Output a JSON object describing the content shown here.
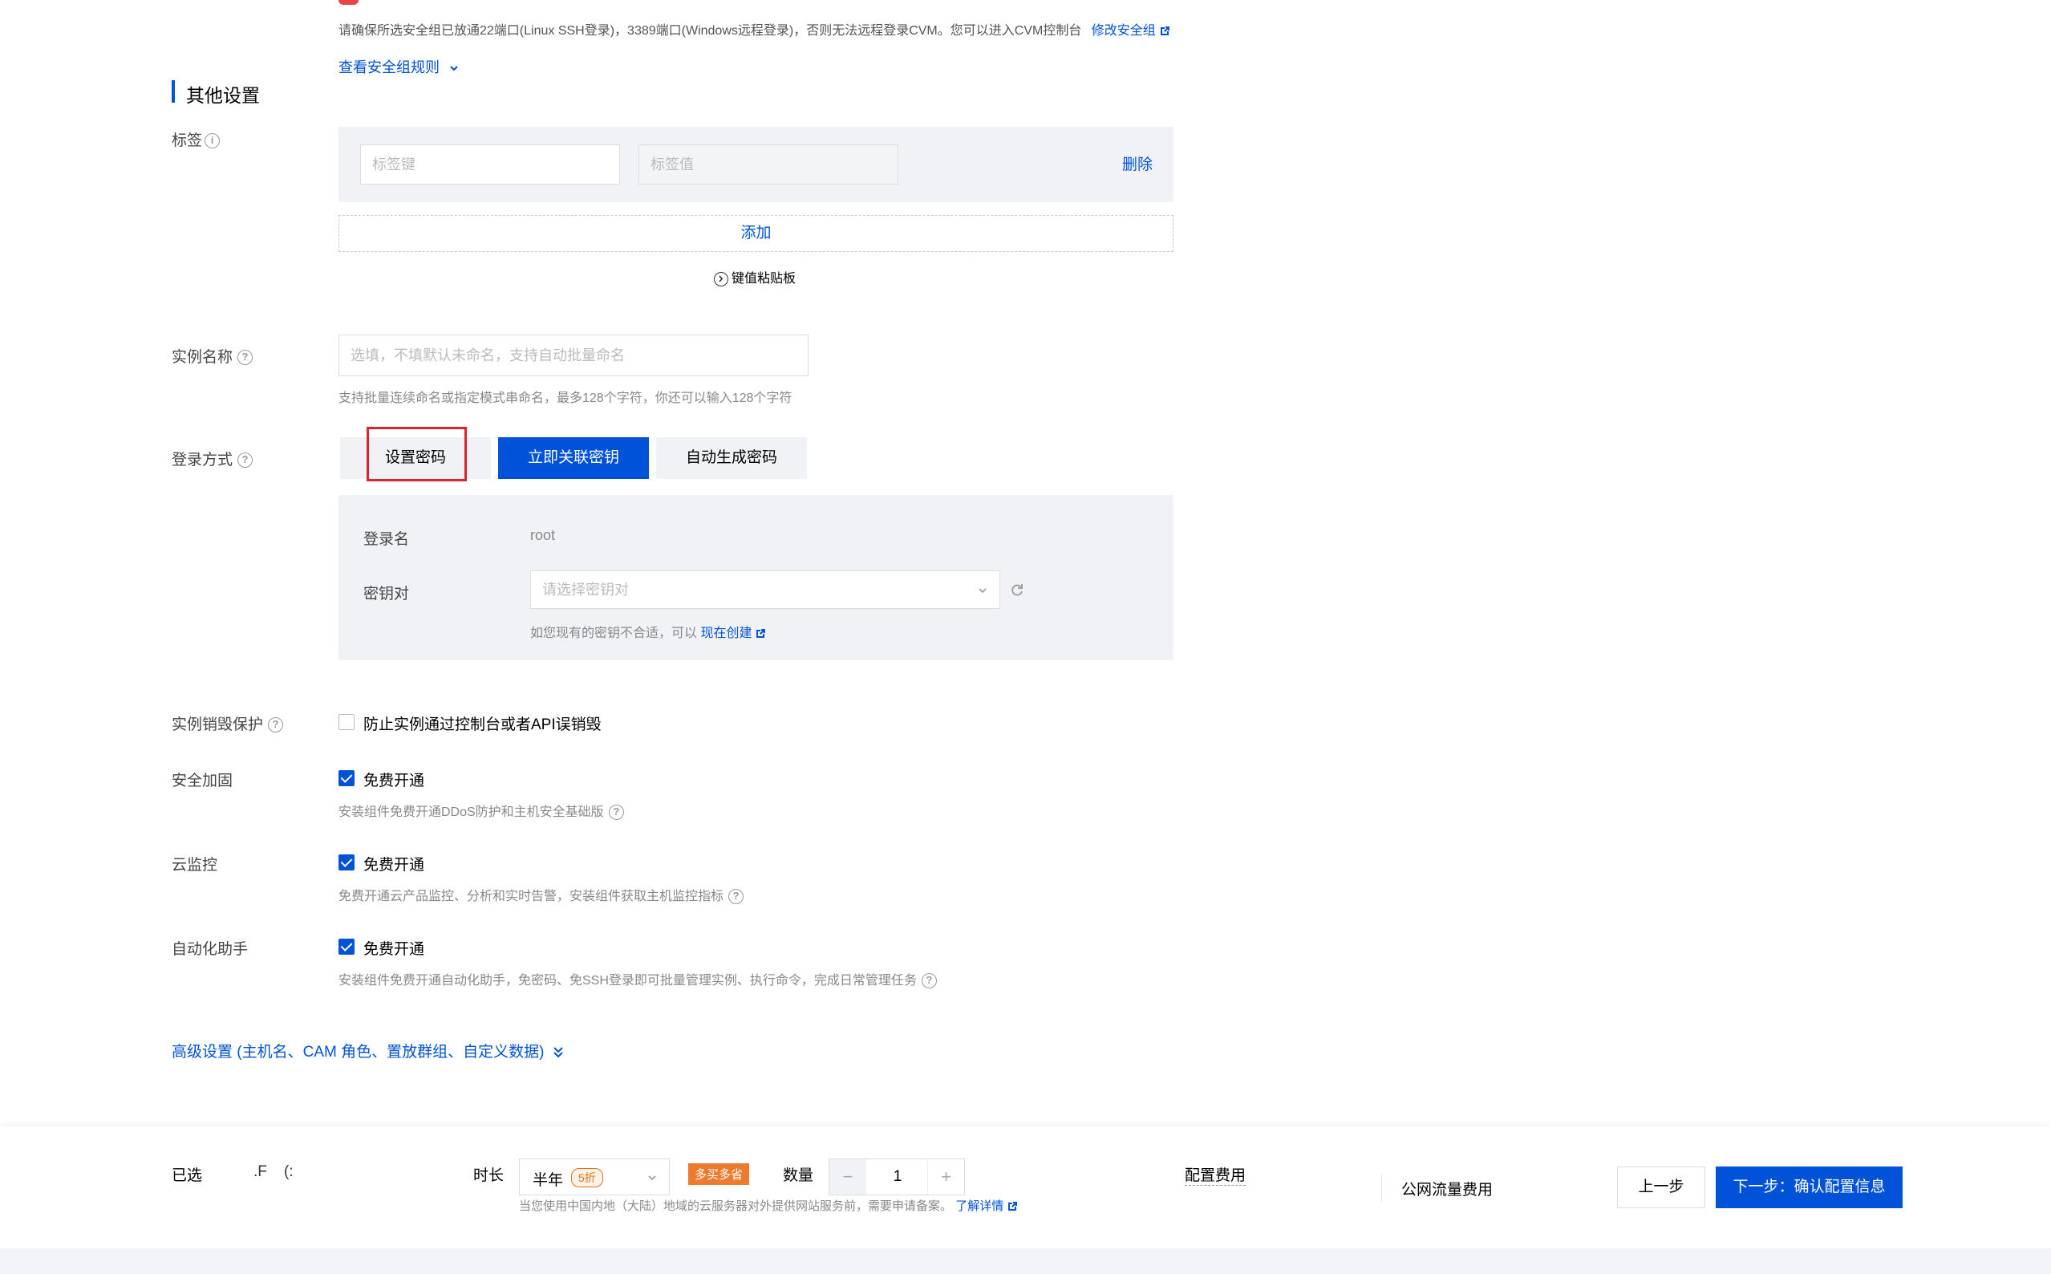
{
  "security_notice": {
    "text": "请确保所选安全组已放通22端口(Linux SSH登录)，3389端口(Windows远程登录)，否则无法远程登录CVM。您可以进入CVM控制台",
    "link": "修改安全组",
    "view_rules": "查看安全组规则"
  },
  "section_title": "其他设置",
  "tags": {
    "label": "标签",
    "key_placeholder": "标签键",
    "value_placeholder": "标签值",
    "delete": "删除",
    "add": "添加",
    "paste": "键值粘贴板"
  },
  "instance_name": {
    "label": "实例名称",
    "placeholder": "选填，不填默认未命名，支持自动批量命名",
    "hint": "支持批量连续命名或指定模式串命名，最多128个字符，你还可以输入128个字符"
  },
  "login": {
    "label": "登录方式",
    "tabs": [
      "设置密码",
      "立即关联密钥",
      "自动生成密码"
    ],
    "username_label": "登录名",
    "username_value": "root",
    "keypair_label": "密钥对",
    "keypair_placeholder": "请选择密钥对",
    "keypair_hint": "如您现有的密钥不合适，可以",
    "keypair_link": "现在创建"
  },
  "destroy_protection": {
    "label": "实例销毁保护",
    "option": "防止实例通过控制台或者API误销毁"
  },
  "security_harden": {
    "label": "安全加固",
    "option": "免费开通",
    "hint": "安装组件免费开通DDoS防护和主机安全基础版"
  },
  "cloud_monitor": {
    "label": "云监控",
    "option": "免费开通",
    "hint": "免费开通云产品监控、分析和实时告警，安装组件获取主机监控指标"
  },
  "automation": {
    "label": "自动化助手",
    "option": "免费开通",
    "hint": "安装组件免费开通自动化助手，免密码、免SSH登录即可批量管理实例、执行命令，完成日常管理任务"
  },
  "advanced": "高级设置 (主机名、CAM 角色、置放群组、自定义数据)",
  "footer": {
    "selected_label": "已选",
    "selected_value": ".F    (:",
    "duration_label": "时长",
    "duration_value": "半年",
    "discount": "5折",
    "promo": "多买多省",
    "quantity_label": "数量",
    "quantity": "1",
    "notice": "当您使用中国内地（大陆）地域的云服务器对外提供网站服务前，需要申请备案。",
    "notice_link": "了解详情",
    "config_fee": "配置费用",
    "traffic_fee": "公网流量费用",
    "prev": "上一步",
    "next": "下一步：确认配置信息"
  }
}
